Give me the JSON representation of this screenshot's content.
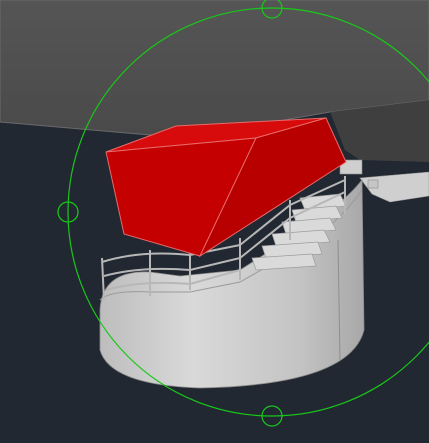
{
  "viewport": {
    "background_color": "#212832",
    "ceiling_color": "#505050",
    "ceiling_side_color": "#404040",
    "selected_object_color": "#CC0000",
    "selected_object_edge_color": "#E05050",
    "cylinder_wall_color": "#C8C8C8",
    "railing_color": "#B4B4B4",
    "stair_step_color": "#D8D8D8",
    "orbit_circle_color": "#19C819",
    "orbit_handles": [
      "top",
      "left",
      "bottom"
    ],
    "orbit_icon": "3d-orbit-arcball-icon"
  }
}
